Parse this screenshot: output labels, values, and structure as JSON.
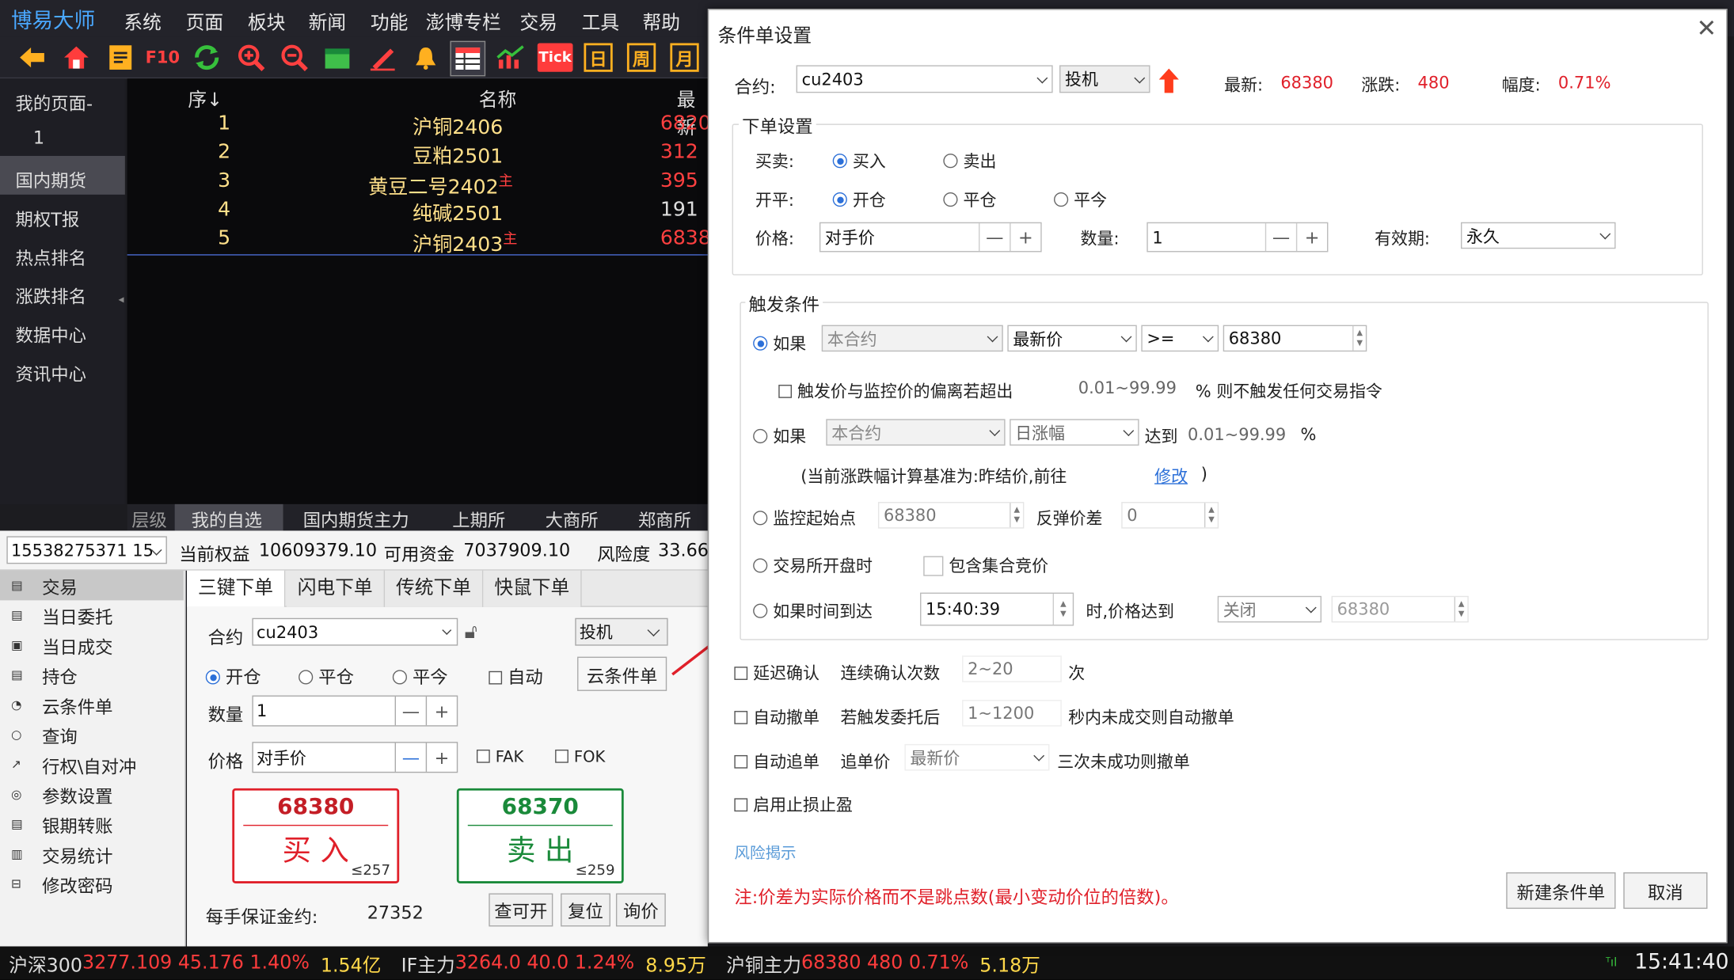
{
  "app": {
    "brand": "博易大师",
    "menu": [
      "系统",
      "页面",
      "板块",
      "新闻",
      "功能",
      "澎博专栏",
      "交易",
      "工具",
      "帮助"
    ]
  },
  "toolbar": {
    "f10": "F10",
    "tick": "Tick",
    "day": "日",
    "week": "周",
    "month": "月"
  },
  "leftnav": {
    "mypage": "我的页面-",
    "mypage_no": "1",
    "items": [
      "国内期货",
      "期权T报",
      "热点排名",
      "涨跌排名",
      "数据中心",
      "资讯中心"
    ]
  },
  "quote": {
    "headers": {
      "no": "序↓",
      "name": "名称",
      "latest": "最新"
    },
    "rows": [
      {
        "no": "1",
        "name": "沪铜2406",
        "tag": "",
        "price": "6820"
      },
      {
        "no": "2",
        "name": "豆粕2501",
        "tag": "",
        "price": "312"
      },
      {
        "no": "3",
        "name": "黄豆二号2402",
        "tag": "主",
        "price": "395"
      },
      {
        "no": "4",
        "name": "纯碱2501",
        "tag": "",
        "price": "191"
      },
      {
        "no": "5",
        "name": "沪铜2403",
        "tag": "主",
        "price": "6838"
      }
    ]
  },
  "qtabs": [
    "层级",
    "我的自选",
    "国内期货主力",
    "上期所",
    "大商所",
    "郑商所"
  ],
  "account": {
    "id": "15538275371",
    "id_suffix": "15",
    "equity_label": "当前权益",
    "equity": "10609379.10",
    "avail_label": "可用资金",
    "avail": "7037909.10",
    "risk_label": "风险度",
    "risk": "33.66"
  },
  "tmenu": [
    "交易",
    "当日委托",
    "当日成交",
    "持仓",
    "云条件单",
    "查询",
    "行权\\自对冲",
    "参数设置",
    "银期转账",
    "交易统计",
    "修改密码"
  ],
  "trade": {
    "tabs": [
      "三键下单",
      "闪电下单",
      "传统下单",
      "快鼠下单"
    ],
    "contract_label": "合约",
    "contract": "cu2403",
    "type": "投机",
    "open": "开仓",
    "close": "平仓",
    "closetoday": "平今",
    "auto": "自动",
    "cloud": "云条件单",
    "qty_label": "数量",
    "qty": "1",
    "price_label": "价格",
    "price": "对手价",
    "fak": "FAK",
    "fok": "FOK",
    "buy_price": "68380",
    "buy_label": "买 入",
    "buy_vol": "≤257",
    "sell_price": "68370",
    "sell_label": "卖 出",
    "sell_vol": "≤259",
    "margin_label": "每手保证金约:",
    "margin": "27352",
    "btn_query": "查可开",
    "btn_reset": "复位",
    "btn_ask": "询价"
  },
  "status": {
    "items": [
      {
        "name": "沪深300",
        "vals": "3277.109 45.176 1.40%",
        "vol": "1.54亿"
      },
      {
        "name": "IF主力",
        "vals": "3264.0 40.0 1.24%",
        "vol": "8.95万"
      },
      {
        "name": "沪铜主力",
        "vals": "68380 480 0.71%",
        "vol": "5.18万"
      }
    ],
    "time": "15:41:40"
  },
  "dialog": {
    "title": "条件单设置",
    "contract_label": "合约:",
    "contract": "cu2403",
    "type": "投机",
    "latest_label": "最新:",
    "latest": "68380",
    "change_label": "涨跌:",
    "change": "480",
    "range_label": "幅度:",
    "range": "0.71%",
    "order_group": "下单设置",
    "bs_label": "买卖:",
    "buy": "买入",
    "sell": "卖出",
    "oc_label": "开平:",
    "open": "开仓",
    "close": "平仓",
    "closetoday": "平今",
    "price_label": "价格:",
    "price": "对手价",
    "qty_label": "数量:",
    "qty": "1",
    "valid_label": "有效期:",
    "valid": "永久",
    "trigger_group": "触发条件",
    "if1": "如果",
    "this_contract": "本合约",
    "latest_price": "最新价",
    "op": ">=",
    "trig_val": "68380",
    "dev_label": "触发价与监控价的偏离若超出",
    "dev_range": "0.01~99.99",
    "dev_suffix": "% 则不触发任何交易指令",
    "if2": "如果",
    "day_change": "日涨幅",
    "reach": "达到",
    "pct_range": "0.01~99.99",
    "pct": "%",
    "basis_note": "(当前涨跌幅计算基准为:昨结价,前往",
    "modify": "修改",
    "basis_end": ")",
    "monitor_label": "监控起始点",
    "monitor_val": "68380",
    "rebound_label": "反弹价差",
    "rebound_val": "0",
    "exch_open": "交易所开盘时",
    "include_auction": "包含集合竞价",
    "time_reach": "如果时间到达",
    "time": "15:40:39",
    "time_suffix": "时,价格达到",
    "off": "关闭",
    "time_price": "68380",
    "delay_label": "延迟确认",
    "delay_text": "连续确认次数",
    "delay_range": "2~20",
    "delay_unit": "次",
    "autocancel_label": "自动撤单",
    "autocancel_text": "若触发委托后",
    "autocancel_range": "1~1200",
    "autocancel_suffix": "秒内未成交则自动撤单",
    "autochase_label": "自动追单",
    "autochase_text": "追单价",
    "autochase_val": "最新价",
    "autochase_suffix": "三次未成功则撤单",
    "stop_label": "启用止损止盈",
    "risk_link": "风险揭示",
    "note": "注:价差为实际价格而不是跳点数(最小变动价位的倍数)。",
    "btn_new": "新建条件单",
    "btn_cancel": "取消"
  },
  "colors": {
    "accent": "#2b6fd8",
    "up": "#e0202a",
    "down": "#1a8a3a"
  }
}
